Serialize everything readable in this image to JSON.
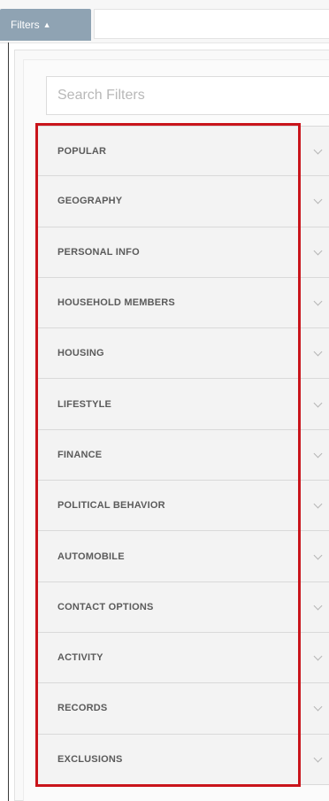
{
  "header": {
    "filters_tab_label": "Filters",
    "filters_tab_caret": "▲"
  },
  "search": {
    "placeholder": "Search Filters",
    "value": ""
  },
  "categories": [
    {
      "label": "POPULAR"
    },
    {
      "label": "GEOGRAPHY"
    },
    {
      "label": "PERSONAL INFO"
    },
    {
      "label": "HOUSEHOLD MEMBERS"
    },
    {
      "label": "HOUSING"
    },
    {
      "label": "LIFESTYLE"
    },
    {
      "label": "FINANCE"
    },
    {
      "label": "POLITICAL BEHAVIOR"
    },
    {
      "label": "AUTOMOBILE"
    },
    {
      "label": "CONTACT OPTIONS"
    },
    {
      "label": "ACTIVITY"
    },
    {
      "label": "RECORDS"
    },
    {
      "label": "EXCLUSIONS"
    }
  ],
  "colors": {
    "tab_background": "#8fa3b3",
    "highlight_border": "#c9141b"
  },
  "icons": {
    "item_expand": "chevron-down-icon",
    "tab_toggle": "caret-up-icon"
  }
}
